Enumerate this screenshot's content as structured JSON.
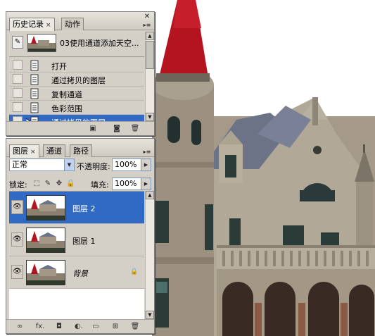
{
  "history": {
    "tabs": [
      {
        "label": "历史记录",
        "close": "×"
      },
      {
        "label": "动作"
      }
    ],
    "snapshot": {
      "label": "03使用通道添加天空..."
    },
    "items": [
      {
        "label": "打开"
      },
      {
        "label": "通过拷贝的图层"
      },
      {
        "label": "复制通道"
      },
      {
        "label": "色彩范围"
      },
      {
        "label": "通过拷贝的图层",
        "selected": true
      }
    ],
    "bottom_icons": [
      "new-document-from-state-icon",
      "new-snapshot-icon",
      "delete-state-icon"
    ]
  },
  "layers": {
    "tabs": [
      {
        "label": "图层",
        "close": "×"
      },
      {
        "label": "通道"
      },
      {
        "label": "路径"
      }
    ],
    "blend_mode": "正常",
    "opacity_label": "不透明度:",
    "opacity_value": "100%",
    "lock_label": "锁定:",
    "fill_label": "填充:",
    "fill_value": "100%",
    "items": [
      {
        "name": "图层 2",
        "selected": true,
        "visible": true
      },
      {
        "name": "图层 1",
        "selected": false,
        "visible": true
      },
      {
        "name": "背景",
        "selected": false,
        "visible": true,
        "locked": true
      }
    ],
    "bottom_icons": [
      "link-layers-icon",
      "layer-style-icon",
      "add-mask-icon",
      "adjustment-layer-icon",
      "new-group-icon",
      "new-layer-icon",
      "delete-layer-icon"
    ],
    "bottom_glyphs": [
      "∞",
      "fx.",
      "◘",
      "◐.",
      "▭",
      "⊞",
      "🗑"
    ]
  },
  "colors": {
    "selection": "#316ac5",
    "panel_bg": "#d4d0c8",
    "roof_red": "#b3141f",
    "sky": "#ffffff"
  }
}
